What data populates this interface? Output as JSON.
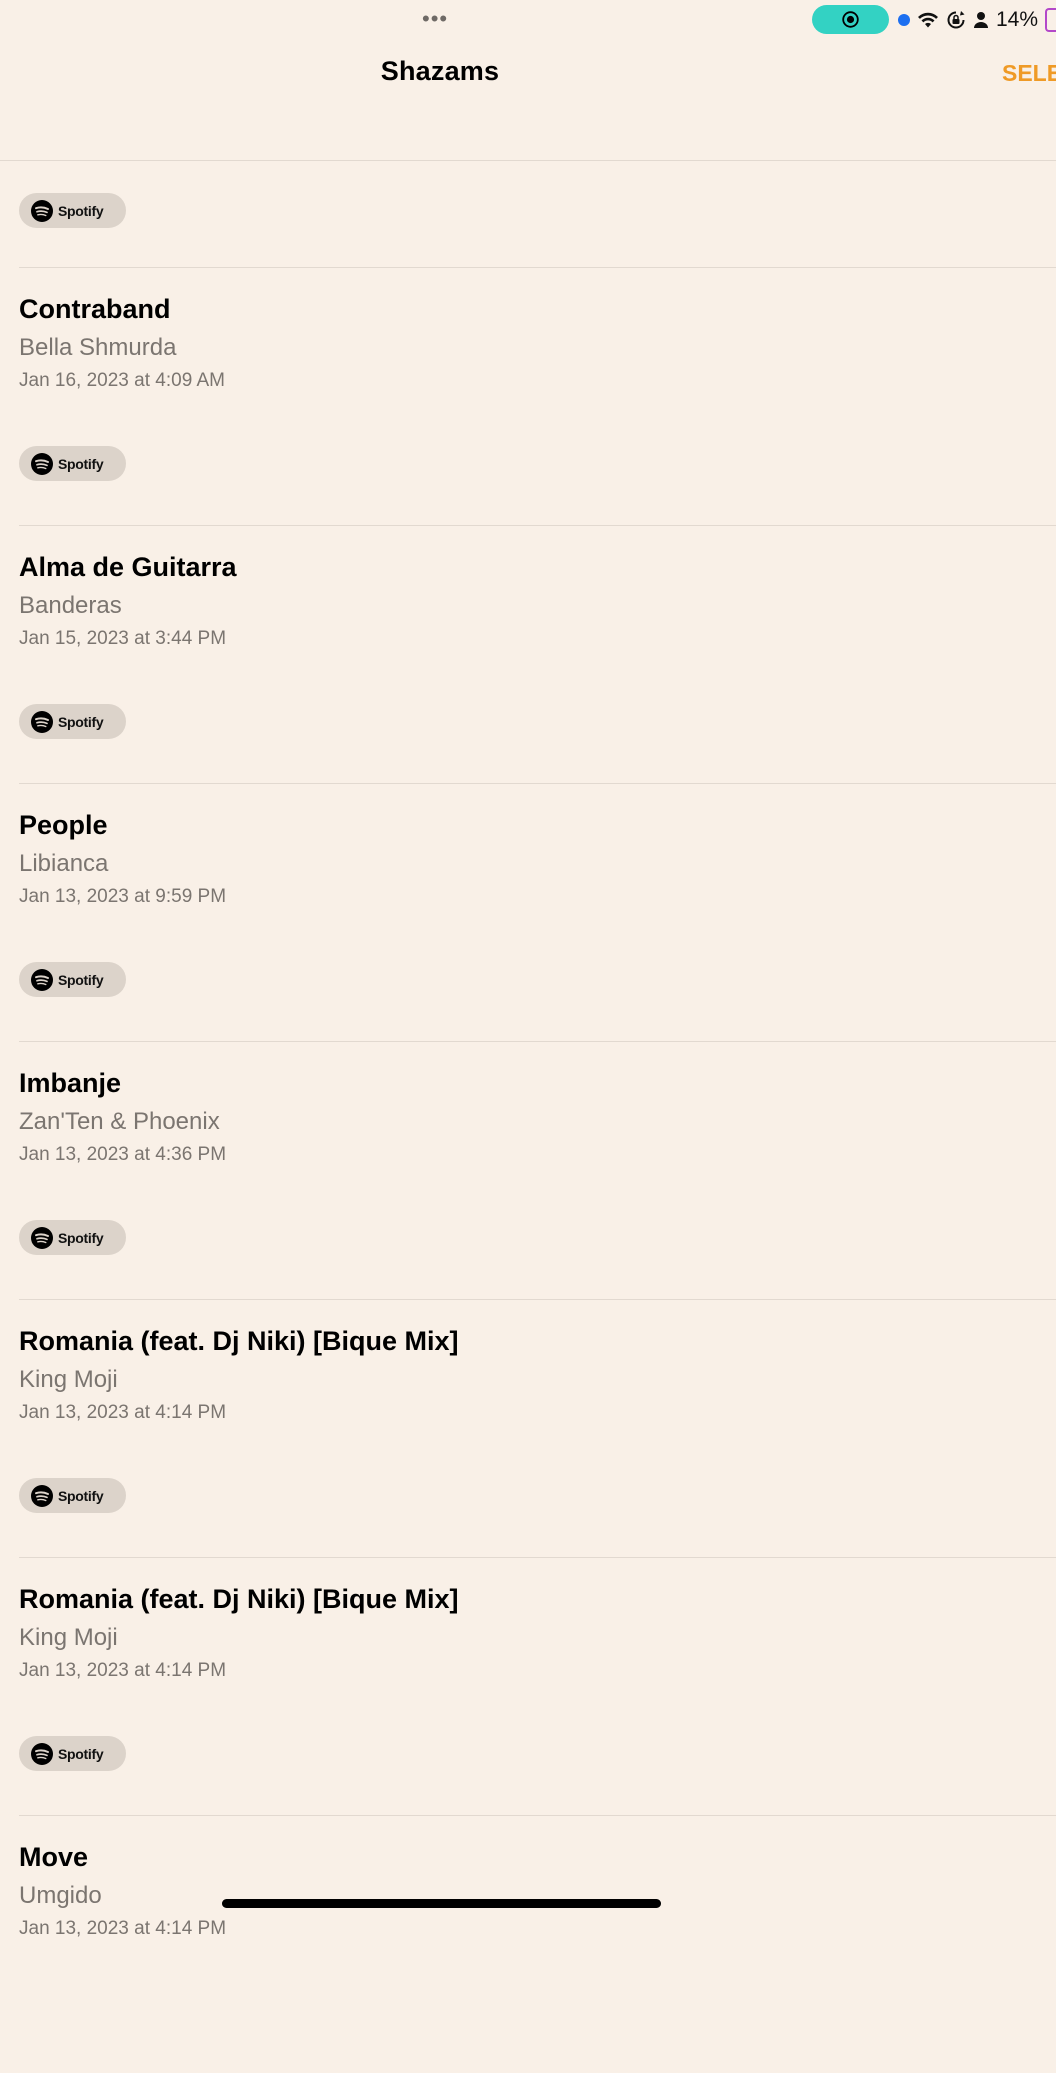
{
  "status_bar": {
    "dots": "•••",
    "battery_text": "14%",
    "icons": [
      "recording-icon",
      "location-dot-icon",
      "wifi-icon",
      "orientation-lock-icon",
      "person-icon",
      "battery-icon"
    ]
  },
  "nav": {
    "title": "Shazams",
    "select_label": "SELE"
  },
  "spotify_label": "Spotify",
  "songs": [
    {
      "title": "Contraband",
      "artist": "Bella Shmurda",
      "date": "Jan 16, 2023 at 4:09 AM"
    },
    {
      "title": "Alma de Guitarra",
      "artist": "Banderas",
      "date": "Jan 15, 2023 at 3:44 PM"
    },
    {
      "title": "People",
      "artist": "Libianca",
      "date": "Jan 13, 2023 at 9:59 PM"
    },
    {
      "title": "Imbanje",
      "artist": "Zan'Ten & Phoenix",
      "date": "Jan 13, 2023 at 4:36 PM"
    },
    {
      "title": "Romania (feat. Dj Niki) [Bique Mix]",
      "artist": "King Moji",
      "date": "Jan 13, 2023 at 4:14 PM"
    },
    {
      "title": "Romania (feat. Dj Niki) [Bique Mix]",
      "artist": "King Moji",
      "date": "Jan 13, 2023 at 4:14 PM"
    },
    {
      "title": "Move",
      "artist": "Umgido",
      "date": "Jan 13, 2023 at 4:14 PM"
    }
  ],
  "colors": {
    "background": "#f9f0e7",
    "accent": "#ef9a26",
    "recording": "#33d2c3"
  }
}
